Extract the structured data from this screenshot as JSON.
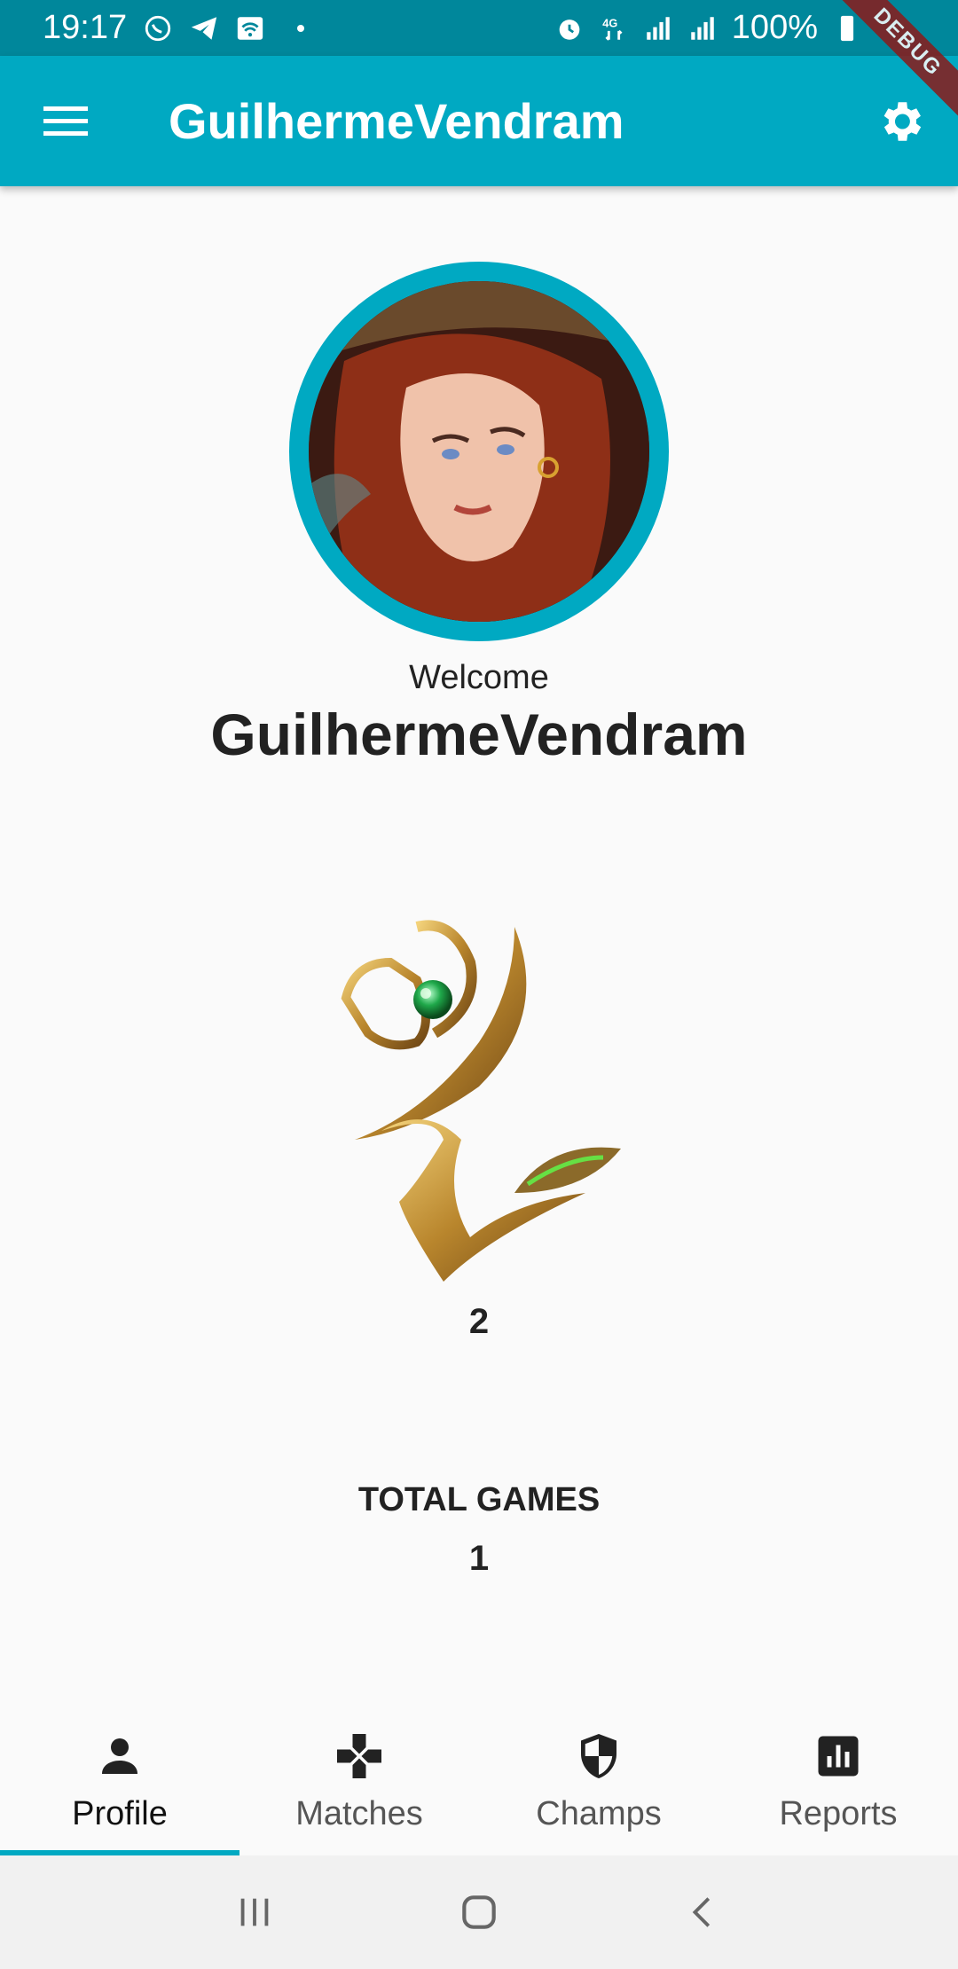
{
  "status_bar": {
    "time": "19:17",
    "battery": "100%",
    "icons": [
      "whatsapp-icon",
      "telegram-icon",
      "wifi-icon",
      "alarm-icon",
      "4g-icon",
      "signal-icon",
      "signal-icon",
      "battery-icon"
    ]
  },
  "app_bar": {
    "title": "GuilhermeVendram",
    "menu_icon": "menu-icon",
    "settings_icon": "settings-icon",
    "debug_label": "DEBUG"
  },
  "profile": {
    "welcome": "Welcome",
    "username": "GuilhermeVendram",
    "rank_value": "2",
    "total_games_label": "TOTAL GAMES",
    "total_games_value": "1"
  },
  "bottom_nav": {
    "items": [
      {
        "label": "Profile",
        "icon": "person-icon",
        "active": true
      },
      {
        "label": "Matches",
        "icon": "gamepad-icon",
        "active": false
      },
      {
        "label": "Champs",
        "icon": "shield-icon",
        "active": false
      },
      {
        "label": "Reports",
        "icon": "bar-chart-icon",
        "active": false
      }
    ]
  },
  "colors": {
    "primary": "#00a9c2",
    "primary_dark": "#00879b",
    "background": "#fafafa"
  }
}
